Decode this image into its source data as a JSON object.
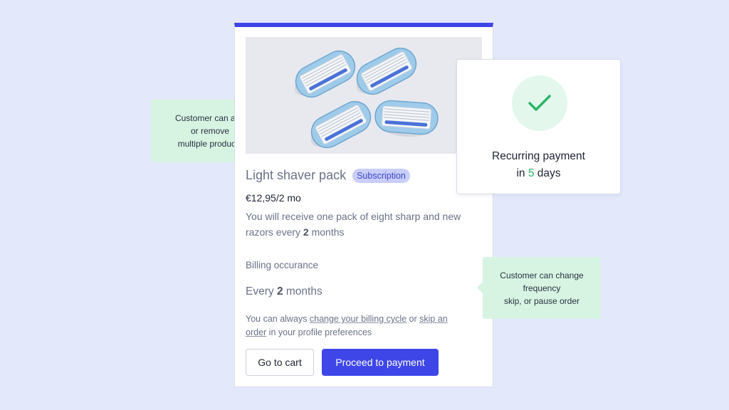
{
  "product": {
    "title": "Light shaver pack",
    "badge": "Subscription",
    "price": "€12,95/2 mo",
    "description_part1": "You will receive one pack of eight sharp and new razors every ",
    "description_bold": "2",
    "description_part2": " months",
    "image_icon": "razor-cartridges-image"
  },
  "billing": {
    "label": "Billing occurance",
    "value_prefix": "Every ",
    "value_bold": "2",
    "value_suffix": " months",
    "info_part1": "You can always ",
    "link_change": "change your billing cycle",
    "info_part2": " or ",
    "link_skip": "skip an order",
    "info_part3": " in your profile preferences"
  },
  "buttons": {
    "cart": "Go to cart",
    "pay": "Proceed to payment"
  },
  "recurring": {
    "line1": "Recurring payment",
    "line2_prefix": "in ",
    "days": "5",
    "line2_suffix": " days",
    "icon": "checkmark-icon"
  },
  "tooltips": {
    "add": [
      "Customer can add",
      "or remove",
      "multiple products"
    ],
    "freq": [
      "Customer can change",
      "frequency",
      "skip, or pause order"
    ]
  },
  "colors": {
    "accent": "#3e46e8",
    "success": "#2fb36a",
    "tooltip_bg": "#d7f4e2",
    "background": "#e4e8fb"
  }
}
